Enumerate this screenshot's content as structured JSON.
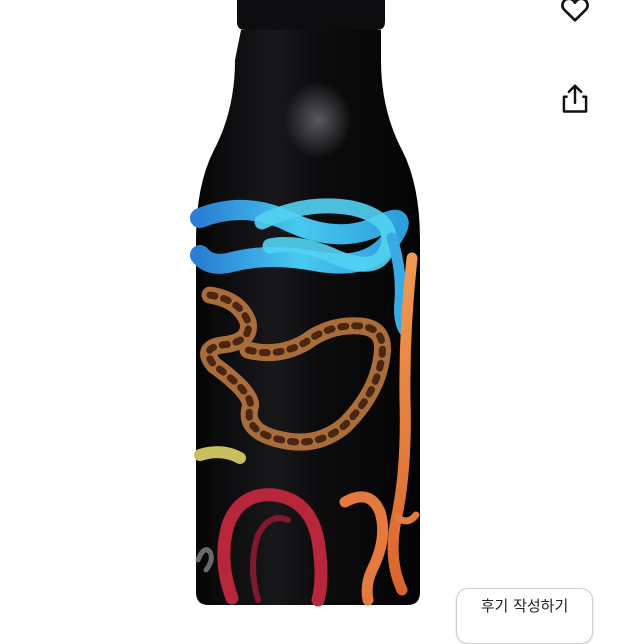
{
  "product": {
    "image_subject": "black-bottle-with-snake-print",
    "colors": {
      "bottle": "#0b0b0d",
      "blue_snake": "#35b6e8",
      "brown_snake": "#a86d3a",
      "red_snake": "#b8263c",
      "orange_snake": "#e57a3e"
    }
  },
  "actions": {
    "wishlist_icon": "heart-icon",
    "share_icon": "share-icon"
  },
  "review_button": {
    "label": "후기 작성하기"
  }
}
